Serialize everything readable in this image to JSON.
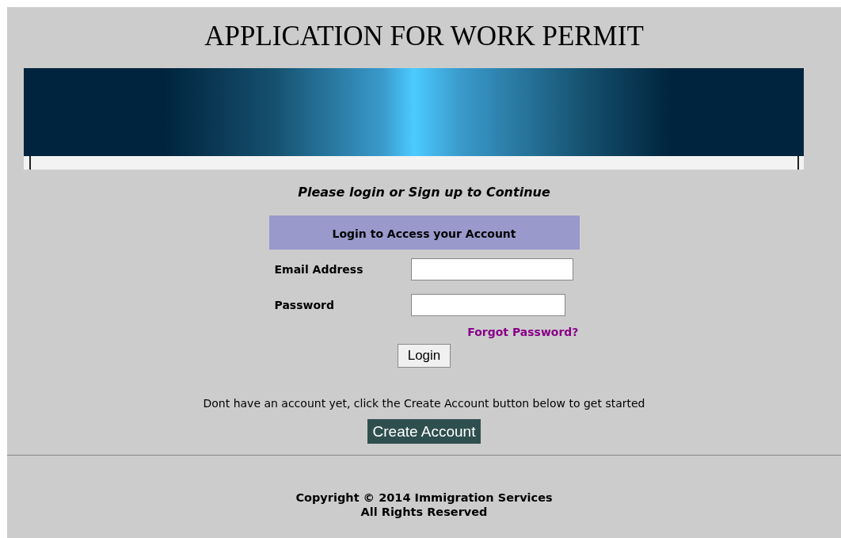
{
  "page_title": "APPLICATION FOR WORK PERMIT",
  "prompt": "Please login or Sign up to Continue",
  "login_form": {
    "heading": "Login to Access your Account",
    "fields": [
      {
        "label": "Email Address",
        "kind": "email"
      },
      {
        "label": "Password",
        "kind": "password"
      }
    ],
    "forgot_link": "Forgot Password?",
    "login_button": "Login"
  },
  "signup_hint": "Dont have an account yet, click the Create Account button below to get started",
  "create_button": "Create Account",
  "footer": {
    "copyright": "Copyright © 2014 Immigration Services",
    "rights": "All Rights Reserved"
  }
}
